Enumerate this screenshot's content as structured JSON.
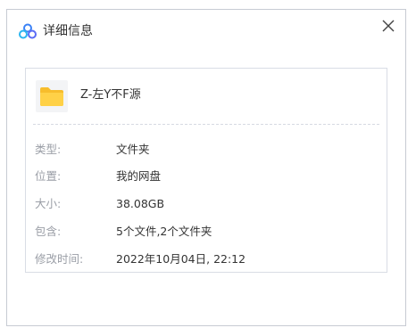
{
  "window": {
    "title": "详细信息",
    "close_label": "×"
  },
  "item": {
    "name": "Z-左Y不F源",
    "icon": "folder-icon"
  },
  "details": [
    {
      "label": "类型:",
      "value": "文件夹"
    },
    {
      "label": "位置:",
      "value": "我的网盘"
    },
    {
      "label": "大小:",
      "value": "38.08GB"
    },
    {
      "label": "包含:",
      "value": "5个文件,2个文件夹"
    },
    {
      "label": "修改时间:",
      "value": "2022年10月04日, 22:12"
    }
  ],
  "colors": {
    "folder": "#ffcc33",
    "brand_blue": "#3b82f6"
  }
}
